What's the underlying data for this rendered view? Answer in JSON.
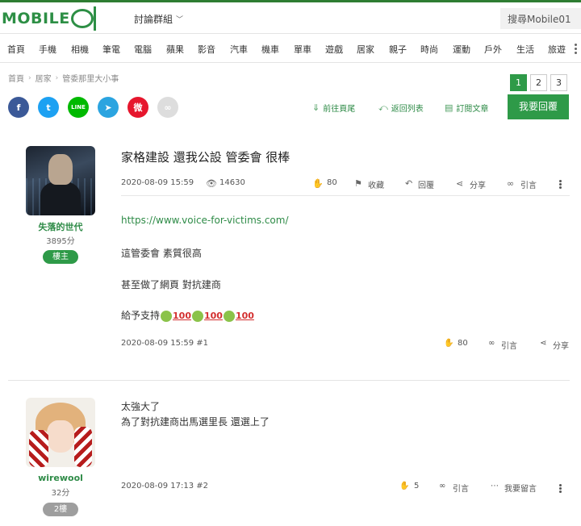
{
  "header": {
    "logo_text": "MOBILE",
    "forum_dropdown": "討論群組",
    "search_placeholder": "搜尋Mobile01"
  },
  "categories": [
    "首頁",
    "手機",
    "相機",
    "筆電",
    "電腦",
    "蘋果",
    "影音",
    "汽車",
    "機車",
    "單車",
    "遊戲",
    "居家",
    "親子",
    "時尚",
    "運動",
    "戶外",
    "生活",
    "旅遊"
  ],
  "breadcrumb": [
    "首頁",
    "居家",
    "管委那里大小事"
  ],
  "pager": [
    "1",
    "2",
    "3"
  ],
  "social": {
    "fb": "f",
    "tw": "t",
    "line": "LINE",
    "tg": "➤",
    "wb": "微",
    "lk": "∞"
  },
  "actions": {
    "first_page": "前往頁尾",
    "back_list": "返回列表",
    "subscribe": "訂閱文章",
    "reply": "我要回覆"
  },
  "post1": {
    "title": "家格建設 還我公設 管委會 很棒",
    "username": "失落的世代",
    "points": "3895分",
    "role": "樓主",
    "datetime": "2020-08-09 15:59",
    "views": "14630",
    "likes": "80",
    "bookmark": "收藏",
    "reply": "回覆",
    "share": "分享",
    "quote": "引言",
    "link": "https://www.voice-for-victims.com/",
    "line1": "這管委會 素質很高",
    "line2": "甚至做了網頁 對抗建商",
    "line3": "給予支持",
    "hundred": "100",
    "footer_datetime": "2020-08-09 15:59 #1",
    "footer_likes": "80",
    "footer_quote": "引言",
    "footer_share": "分享"
  },
  "post2": {
    "username": "wirewool",
    "points": "32分",
    "floor": "2樓",
    "line1": "太強大了",
    "line2": "為了對抗建商出馬選里長 還選上了",
    "footer_datetime": "2020-08-09 17:13 #2",
    "likes": "5",
    "quote": "引言",
    "comment": "我要留言"
  },
  "colors": {
    "brand": "#2e9a48",
    "link": "#2e8b47",
    "text": "#222222"
  }
}
